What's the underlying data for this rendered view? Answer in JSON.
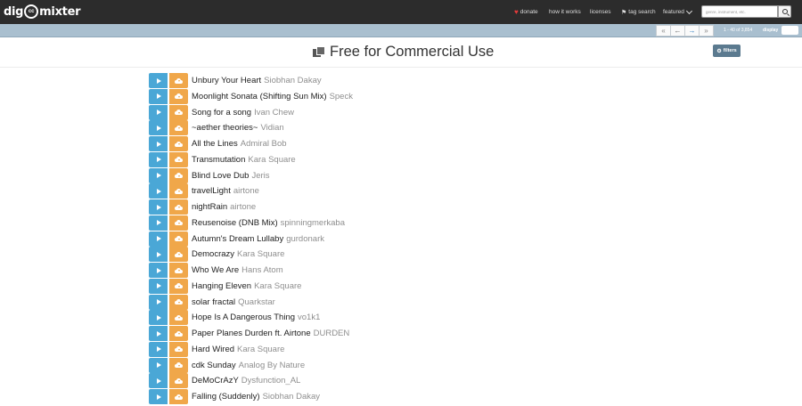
{
  "header": {
    "logo": {
      "left": "dig",
      "cc": "cc",
      "right": "mixter"
    },
    "nav": {
      "donate": "donate",
      "how_it_works": "how it works",
      "licenses": "licenses",
      "tag_search": "tag search",
      "featured": "featured"
    },
    "search": {
      "placeholder": "genre, instrument, etc."
    }
  },
  "pager": {
    "first": "«",
    "prev": "←",
    "next": "→",
    "last": "»",
    "range": "1 - 40 of 3,854",
    "display_label": "display"
  },
  "page": {
    "title": "Free for Commercial Use",
    "filters_label": "filters"
  },
  "colors": {
    "play": "#4aa7d6",
    "download": "#f0a74a",
    "topbar": "#2c2c2c",
    "pagerbar": "#a9bfcf"
  },
  "tracks": [
    {
      "title": "Unbury Your Heart",
      "artist": "Siobhan Dakay"
    },
    {
      "title": "Moonlight Sonata (Shifting Sun Mix)",
      "artist": "Speck"
    },
    {
      "title": "Song for a song",
      "artist": "Ivan Chew"
    },
    {
      "title": "~aether theories~",
      "artist": "Vidian"
    },
    {
      "title": "All the Lines",
      "artist": "Admiral Bob"
    },
    {
      "title": "Transmutation",
      "artist": "Kara Square"
    },
    {
      "title": "Blind Love Dub",
      "artist": "Jeris"
    },
    {
      "title": "travelLight",
      "artist": "airtone"
    },
    {
      "title": "nightRain",
      "artist": "airtone"
    },
    {
      "title": "Reusenoise (DNB Mix)",
      "artist": "spinningmerkaba"
    },
    {
      "title": "Autumn's Dream Lullaby",
      "artist": "gurdonark"
    },
    {
      "title": "Democrazy",
      "artist": "Kara Square"
    },
    {
      "title": "Who We Are",
      "artist": "Hans Atom"
    },
    {
      "title": "Hanging Eleven",
      "artist": "Kara Square"
    },
    {
      "title": "solar fractal",
      "artist": "Quarkstar"
    },
    {
      "title": "Hope Is A Dangerous Thing",
      "artist": "vo1k1"
    },
    {
      "title": "Paper Planes Durden ft. Airtone",
      "artist": "DURDEN"
    },
    {
      "title": "Hard Wired",
      "artist": "Kara Square"
    },
    {
      "title": "cdk Sunday",
      "artist": "Analog By Nature"
    },
    {
      "title": "DeMoCrAzY",
      "artist": "Dysfunction_AL"
    },
    {
      "title": "Falling (Suddenly)",
      "artist": "Siobhan Dakay"
    }
  ]
}
